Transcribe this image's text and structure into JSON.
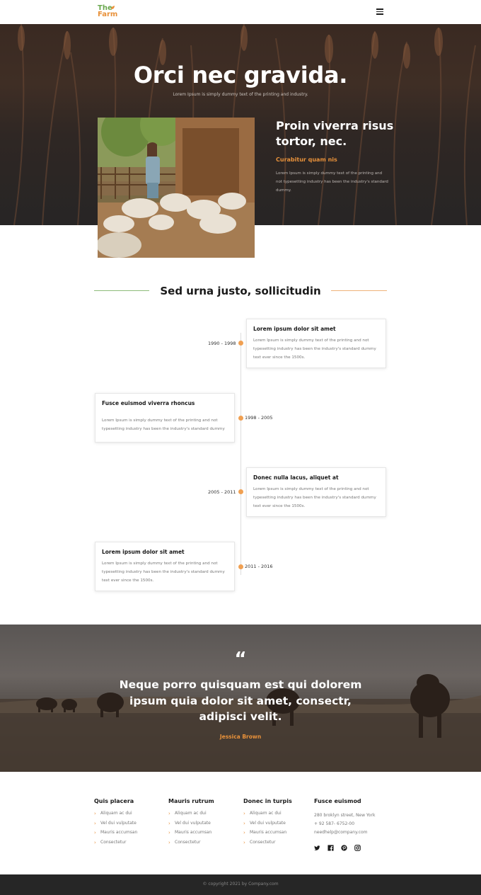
{
  "brand": {
    "line1": "The",
    "line2": "Farm",
    "green": "#6aa84f",
    "orange": "#e8913a"
  },
  "nav": {
    "menu_icon": "hamburger-icon"
  },
  "hero": {
    "title": "Orci nec gravida.",
    "subtitle": "Lorem Ipsum is simply dummy text of the printing and industry.",
    "feature_title": "Proin viverra risus tortor, nec.",
    "feature_subtitle": "Curabitur quam nis",
    "feature_text": "Lorem Ipsum is simply dummy text of the printing and not typesetting industry has been the industry's standard dummy."
  },
  "timeline": {
    "heading": "Sed urna justo, sollicitudin",
    "items": [
      {
        "date": "1990 - 1998",
        "title": "Lorem ipsum dolor sit amet",
        "text": "Lorem Ipsum is simply dummy text of the printing and not typesetting industry has been the industry's standard dummy text ever since the 1500s."
      },
      {
        "date": "1998 - 2005",
        "title": "Fusce euismod viverra rhoncus",
        "text": "Lorem Ipsum is simply dummy text of the printing and not typesetting industry has been the industry's standard dummy"
      },
      {
        "date": "2005 - 2011",
        "title": "Donec nulla lacus, aliquet at",
        "text": "Lorem Ipsum is simply dummy text of the printing and not typesetting industry has been the industry's standard dummy text ever since the 1500s."
      },
      {
        "date": "2011 - 2016",
        "title": "Lorem ipsum dolor sit amet",
        "text": "Lorem Ipsum is simply dummy text of the printing and not typesetting industry has been the industry's standard dummy text ever since the 1500s."
      }
    ]
  },
  "testimonial": {
    "quote_mark": "“",
    "quote": "Neque porro quisquam est qui dolorem ipsum quia dolor sit amet, consectr, adipisci velit.",
    "author": "Jessica Brown"
  },
  "footer": {
    "columns": [
      {
        "heading": "Quis placera",
        "links": [
          "Aliquam ac dui",
          "Vel dui vulputate",
          "Mauris accumsan",
          "Consectetur"
        ]
      },
      {
        "heading": "Mauris rutrum",
        "links": [
          "Aliquam ac dui",
          "Vel dui vulputate",
          "Mauris accumsan",
          "Consectetur"
        ]
      },
      {
        "heading": "Donec in turpis",
        "links": [
          "Aliquam ac dui",
          "Vel dui vulputate",
          "Mauris accumsan",
          "Consectetur"
        ]
      }
    ],
    "contact": {
      "heading": "Fusce euismod",
      "address": "280 broklyn street, New York",
      "phone": "+ 92 587- 6752-00",
      "email": "needhelp@company.com"
    },
    "social": [
      "twitter-icon",
      "facebook-icon",
      "pinterest-icon",
      "instagram-icon"
    ],
    "copyright": "© copyright 2021 by Company.com"
  }
}
